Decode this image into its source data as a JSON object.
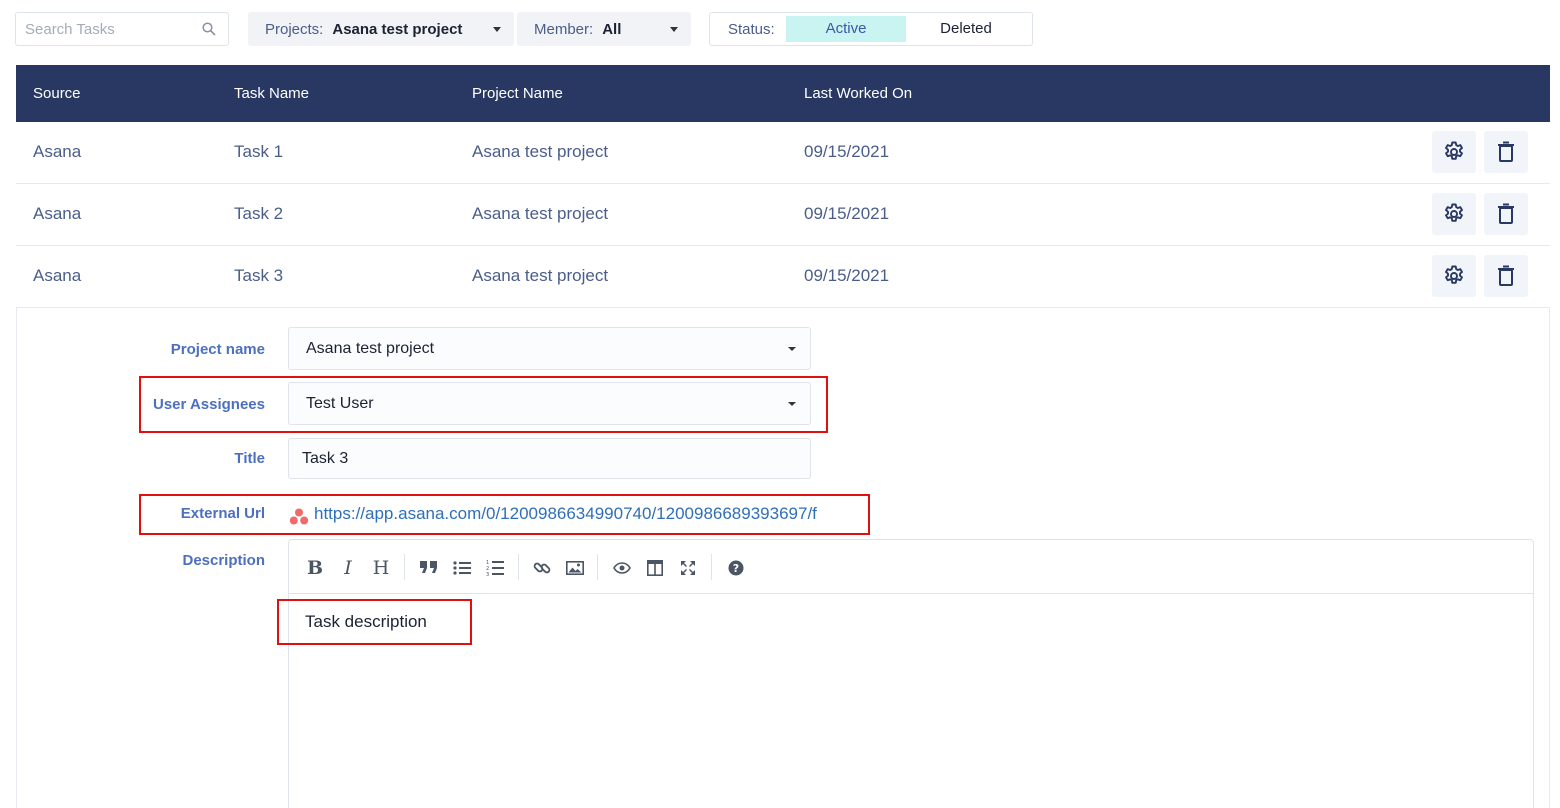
{
  "filters": {
    "search_placeholder": "Search Tasks",
    "projects": {
      "label": "Projects:",
      "value": "Asana test project"
    },
    "member": {
      "label": "Member:",
      "value": "All"
    },
    "status": {
      "label": "Status:",
      "options": [
        "Active",
        "Deleted"
      ],
      "selected": "Active"
    }
  },
  "table": {
    "headers": [
      "Source",
      "Task Name",
      "Project Name",
      "Last Worked On"
    ],
    "rows": [
      {
        "source": "Asana",
        "task": "Task 1",
        "project": "Asana test project",
        "date": "09/15/2021"
      },
      {
        "source": "Asana",
        "task": "Task 2",
        "project": "Asana test project",
        "date": "09/15/2021"
      },
      {
        "source": "Asana",
        "task": "Task 3",
        "project": "Asana test project",
        "date": "09/15/2021"
      }
    ]
  },
  "form": {
    "project_label": "Project name",
    "project_value": "Asana test project",
    "assignees_label": "User Assignees",
    "assignees_value": "Test User",
    "title_label": "Title",
    "title_value": "Task 3",
    "url_label": "External Url",
    "url_value": "https://app.asana.com/0/1200986634990740/1200986689393697/f",
    "description_label": "Description",
    "description_value": "Task description"
  },
  "editor_toolbar": [
    "bold",
    "italic",
    "heading",
    "quote",
    "unordered-list",
    "ordered-list",
    "link",
    "image",
    "preview",
    "side-by-side",
    "fullscreen",
    "guide"
  ],
  "colors": {
    "header_bg": "#283862",
    "active_status_bg": "#c9f4f2",
    "label_blue": "#4d6fc0",
    "link_blue": "#2e6fb7",
    "highlight_red": "#e01010"
  }
}
